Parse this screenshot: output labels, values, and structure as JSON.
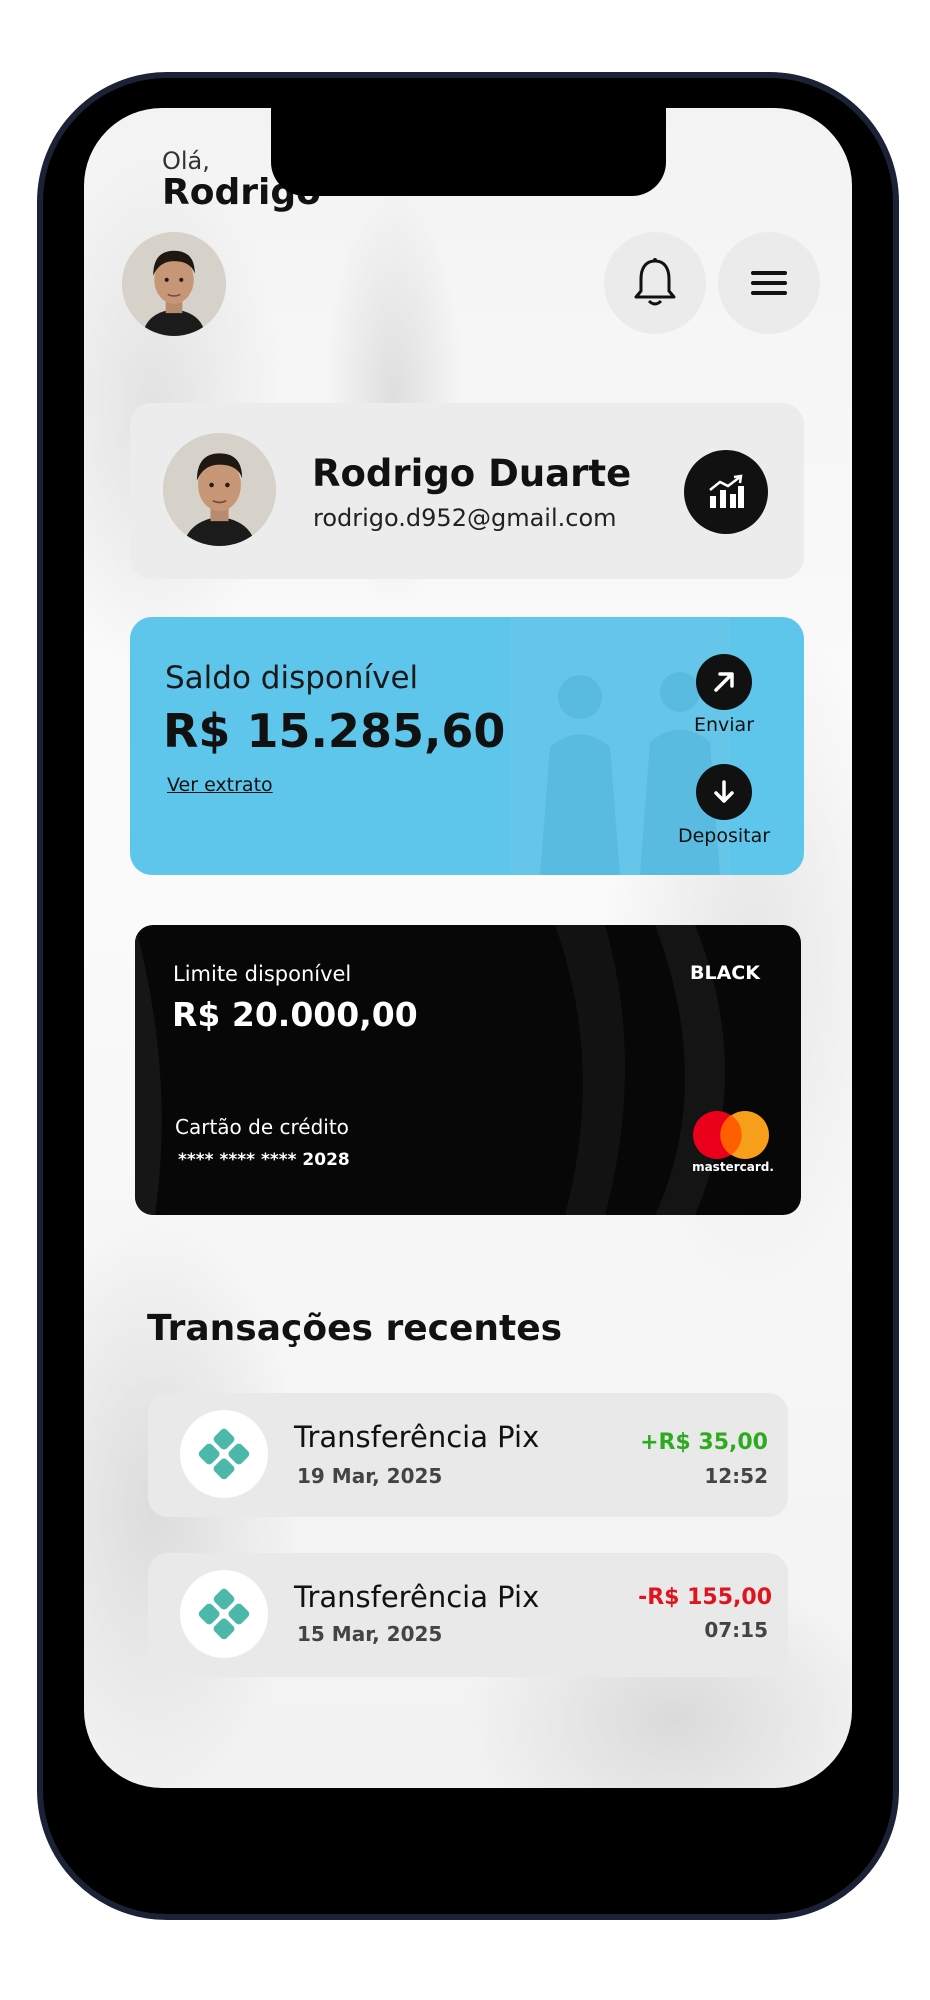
{
  "header": {
    "greeting": "Olá,",
    "user_name": "Rodrigo",
    "icons": [
      "bell-icon",
      "menu-icon"
    ]
  },
  "profile": {
    "full_name": "Rodrigo Duarte",
    "email": "rodrigo.d952@gmail.com",
    "action_icon": "chart-growth-icon"
  },
  "balance": {
    "label": "Saldo disponível",
    "value": "R$ 15.285,60",
    "link": "Ver extrato",
    "actions": [
      {
        "label": "Enviar",
        "icon": "arrow-up-right-icon"
      },
      {
        "label": "Depositar",
        "icon": "arrow-down-icon"
      }
    ]
  },
  "credit_card": {
    "limit_label": "Limite disponível",
    "limit_value": "R$ 20.000,00",
    "tier": "BLACK",
    "card_type": "Cartão de crédito",
    "card_number": "**** **** **** 2028",
    "brand": "mastercard."
  },
  "transactions": {
    "title": "Transações recentes",
    "items": [
      {
        "title": "Transferência Pix",
        "date": "19 Mar, 2025",
        "amount": "+R$ 35,00",
        "time": "12:52",
        "amount_color": "#2eaa1f",
        "icon": "pix-icon"
      },
      {
        "title": "Transferência Pix",
        "date": "15 Mar, 2025",
        "amount": "-R$ 155,00",
        "time": "07:15",
        "amount_color": "#e0141e",
        "icon": "pix-icon"
      }
    ]
  },
  "colors": {
    "balance_card": "#5ec6eb",
    "credit_card": "#070707",
    "positive": "#2eaa1f",
    "negative": "#e0141e",
    "pix": "#4bb8a9"
  }
}
